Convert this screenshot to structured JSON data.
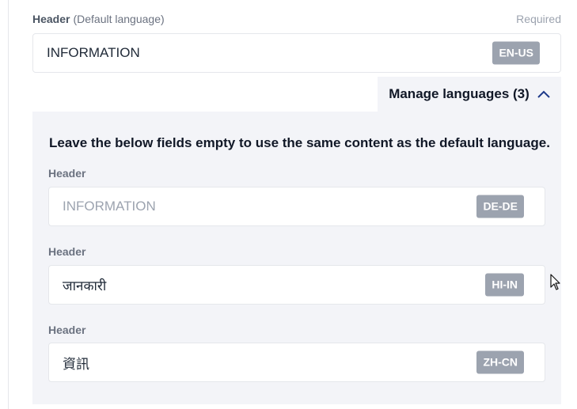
{
  "default_field": {
    "label": "Header",
    "sublabel": "(Default language)",
    "required": "Required",
    "value": "INFORMATION",
    "locale": "EN-US"
  },
  "manage": {
    "label": "Manage languages (3)",
    "icon": "chevron-up-icon"
  },
  "panel": {
    "hint": "Leave the below fields empty to use the same content as the default language.",
    "fields": [
      {
        "label": "Header",
        "placeholder": "INFORMATION",
        "value": "",
        "locale": "DE-DE"
      },
      {
        "label": "Header",
        "placeholder": "",
        "value": "जानकारी",
        "locale": "HI-IN"
      },
      {
        "label": "Header",
        "placeholder": "",
        "value": "資訊",
        "locale": "ZH-CN"
      }
    ]
  },
  "colors": {
    "badge": "#9ca3af",
    "panel_bg": "#f3f4f8",
    "border": "#e5e7eb"
  }
}
